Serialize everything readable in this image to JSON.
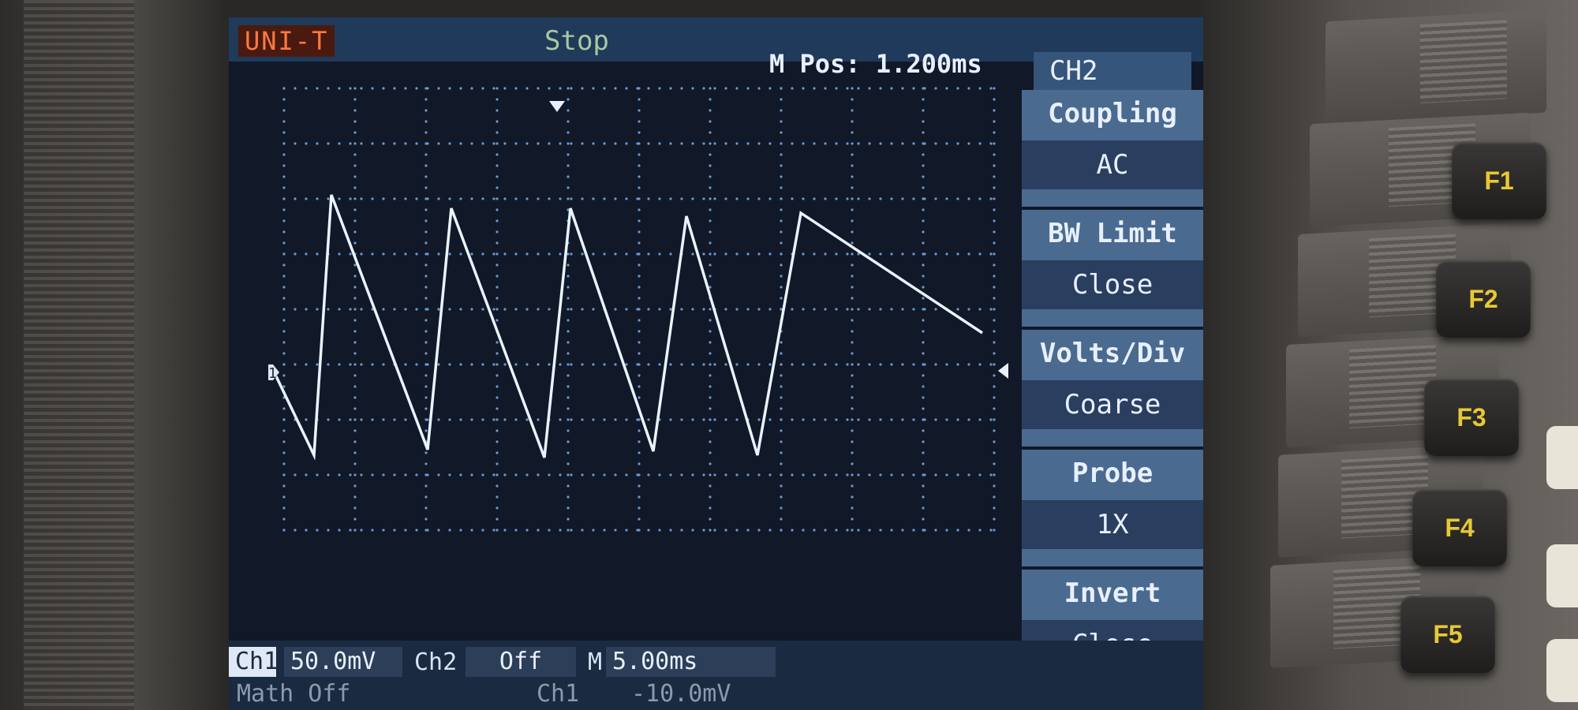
{
  "scope": {
    "brand": "UNI-T",
    "run_status": "Stop",
    "horizontal_position": "M Pos: 1.200ms",
    "active_channel": "CH2"
  },
  "menu": [
    {
      "label": "Coupling",
      "value": "AC"
    },
    {
      "label": "BW Limit",
      "value": "Close"
    },
    {
      "label": "Volts/Div",
      "value": "Coarse"
    },
    {
      "label": "Probe",
      "value": "1X"
    },
    {
      "label": "Invert",
      "value": "Close"
    }
  ],
  "function_keys": [
    "F1",
    "F2",
    "F3",
    "F4",
    "F5"
  ],
  "bottom": {
    "ch1_label": "Ch1",
    "ch1_scale": "50.0mV",
    "ch2_label": "Ch2",
    "ch2_scale": "Off",
    "timebase_marker": "M",
    "timebase": "5.00ms",
    "math": "Math  Off",
    "trigger_source": "Ch1",
    "trigger_level": "-10.0mV"
  },
  "markers": {
    "ch1_ground": "1"
  },
  "waveform": {
    "shape": "sawtooth",
    "color": "#e8f4ff",
    "peaks_visible": 5
  }
}
